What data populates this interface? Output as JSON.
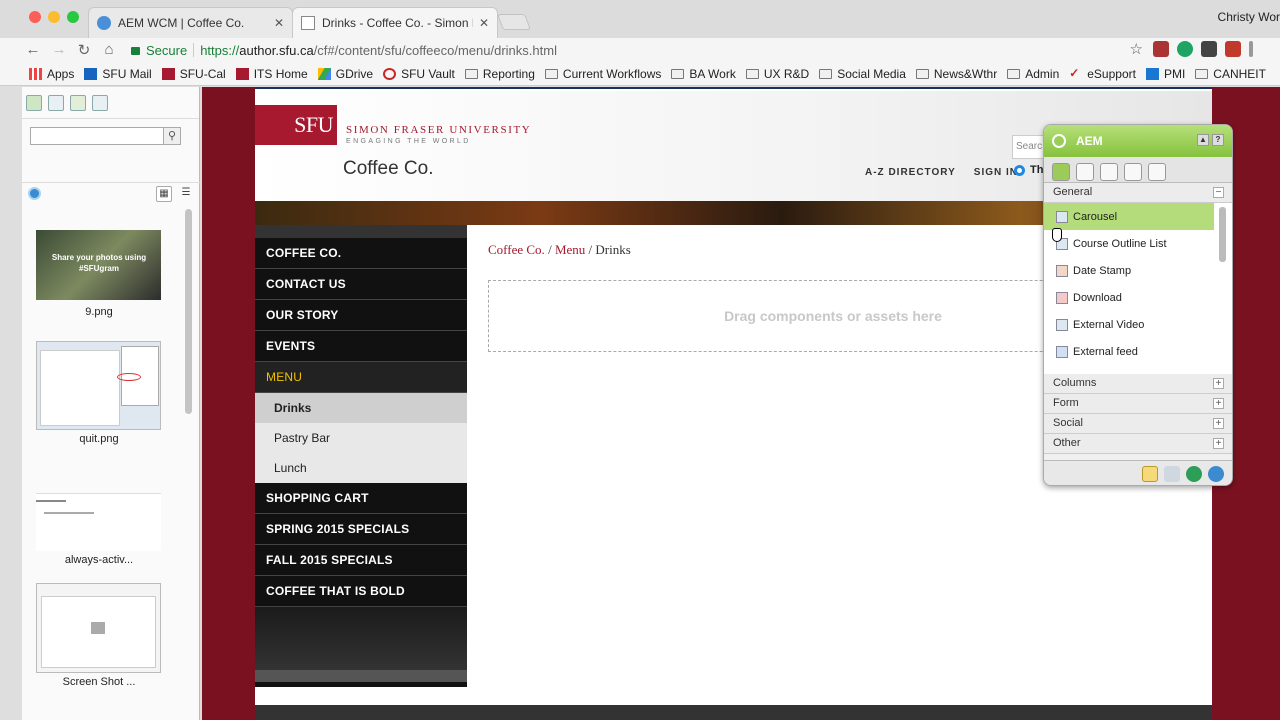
{
  "browser": {
    "tabs": [
      {
        "title": "AEM WCM | Coffee Co.",
        "active": false
      },
      {
        "title": "Drinks - Coffee Co. - Simon Fr",
        "active": true
      }
    ],
    "user": "Christy Wor",
    "address": {
      "secure_label": "Secure",
      "scheme": "https://",
      "host": "author.sfu.ca",
      "path": "/cf#/content/sfu/coffeeco/menu/drinks.html"
    },
    "bookmarks": [
      "Apps",
      "SFU Mail",
      "SFU-Cal",
      "ITS Home",
      "GDrive",
      "SFU Vault",
      "Reporting",
      "Current Workflows",
      "BA Work",
      "UX R&D",
      "Social Media",
      "News&Wthr",
      "Admin",
      "eSupport",
      "PMI",
      "CANHEIT"
    ]
  },
  "assets": {
    "items": [
      {
        "label": "9.png",
        "caption": "Share your photos using #SFUgram"
      },
      {
        "label": "quit.png"
      },
      {
        "label": "always-activ..."
      },
      {
        "label": "Screen Shot ..."
      }
    ]
  },
  "site": {
    "logo": "SFU",
    "university": "SIMON FRASER UNIVERSITY",
    "tagline": "ENGAGING THE WORLD",
    "title": "Coffee Co.",
    "links": [
      "A-Z DIRECTORY",
      "SIGN IN"
    ],
    "search_placeholder": "Searc",
    "radio_label": "Th",
    "nav": [
      "COFFEE CO.",
      "CONTACT US",
      "OUR STORY",
      "EVENTS",
      "MENU",
      "SHOPPING CART",
      "SPRING 2015 SPECIALS",
      "FALL 2015 SPECIALS",
      "COFFEE THAT IS BOLD"
    ],
    "subnav": [
      "Drinks",
      "Pastry Bar",
      "Lunch"
    ],
    "breadcrumb": {
      "home": "Coffee Co.",
      "menu": "Menu",
      "current": "Drinks",
      "sep": "/"
    },
    "dropzone": "Drag components or assets here"
  },
  "sidekick": {
    "title": "AEM",
    "group_general": "General",
    "components": [
      "Carousel",
      "Course Outline List",
      "Date Stamp",
      "Download",
      "External Video",
      "External feed"
    ],
    "groups": [
      "Columns",
      "Form",
      "Social",
      "Other"
    ],
    "colors": {
      "header": "#86c23d",
      "highlight": "#b4dc7a"
    }
  }
}
